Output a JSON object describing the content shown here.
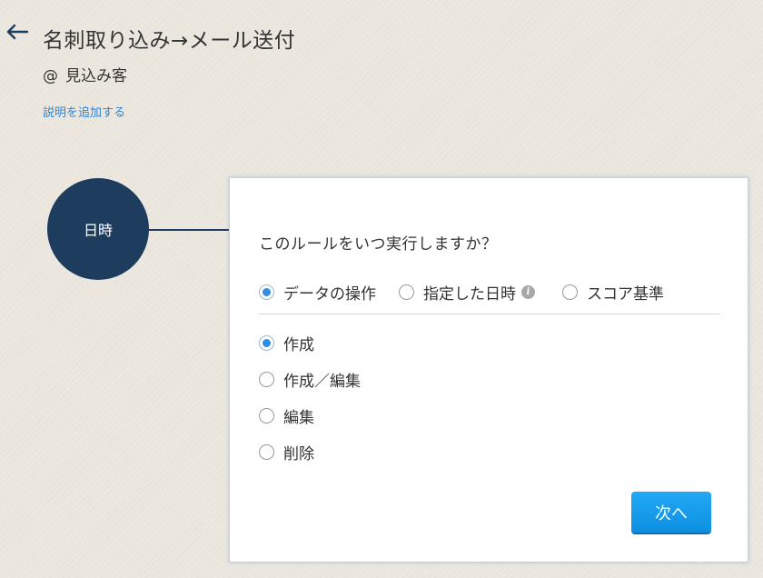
{
  "header": {
    "title": "名刺取り込み→メール送付",
    "object_prefix": "@",
    "object_name": "見込み客",
    "add_description_link": "説明を追加する"
  },
  "flow": {
    "node_label": "日時"
  },
  "panel": {
    "question": "このルールをいつ実行しますか？",
    "trigger_options": [
      {
        "label": "データの操作",
        "selected": true
      },
      {
        "label": "指定した日時",
        "selected": false,
        "has_info_icon": true
      },
      {
        "label": "スコア基準",
        "selected": false
      }
    ],
    "info_icon_glyph": "i",
    "action_options": [
      {
        "label": "作成",
        "selected": true
      },
      {
        "label": "作成／編集",
        "selected": false
      },
      {
        "label": "編集",
        "selected": false
      },
      {
        "label": "削除",
        "selected": false
      }
    ],
    "next_button_label": "次へ"
  },
  "colors": {
    "background": "#ebe7df",
    "node": "#1e3d5e",
    "link": "#2e84d4",
    "radio_selected": "#2f8ee5",
    "button": "#1a9ff0"
  },
  "icons": {
    "back": "arrow-left-icon",
    "info": "info-icon"
  }
}
